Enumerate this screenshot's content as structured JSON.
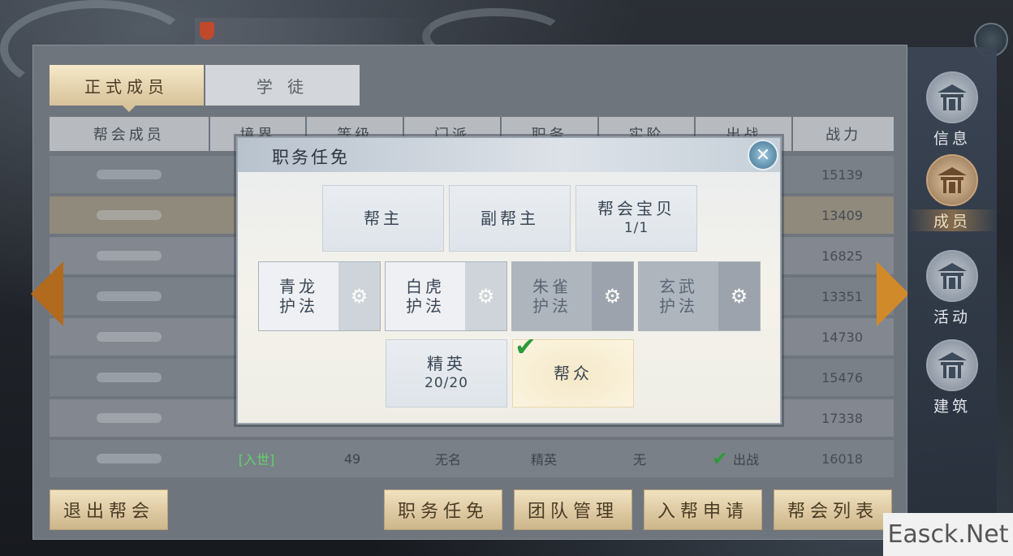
{
  "tabs": [
    {
      "label": "正式成员",
      "active": true
    },
    {
      "label": "学 徒",
      "active": false
    }
  ],
  "table": {
    "headers": [
      "帮会成员",
      "境界",
      "等级",
      "门派",
      "职务",
      "实阶",
      "出战",
      "战力"
    ],
    "powers": [
      "15139",
      "13409",
      "16825",
      "13351",
      "14730",
      "15476",
      "17338",
      "16018"
    ],
    "last_row": {
      "realm": "[入世]",
      "level": "49",
      "school": "无名",
      "position": "精英",
      "rank": "无",
      "battle": "出战",
      "power": "16018"
    }
  },
  "bottom_buttons": {
    "quit": "退出帮会",
    "appoint": "职务任免",
    "team": "团队管理",
    "apply": "入帮申请",
    "list": "帮会列表"
  },
  "sidebar": [
    {
      "label": "信息",
      "icon": "pavilion-icon",
      "active": false
    },
    {
      "label": "成员",
      "icon": "pavilion-icon",
      "active": true
    },
    {
      "label": "活动",
      "icon": "pavilion-icon",
      "active": false
    },
    {
      "label": "建筑",
      "icon": "pavilion-icon",
      "active": false
    }
  ],
  "modal": {
    "title": "职务任免",
    "roles_row1": [
      {
        "label": "帮主",
        "count": ""
      },
      {
        "label": "副帮主",
        "count": ""
      },
      {
        "label": "帮会宝贝",
        "count": "1/1"
      }
    ],
    "roles_row2": [
      {
        "label": "青龙护法",
        "line1": "青龙",
        "line2": "护法",
        "dim": false
      },
      {
        "label": "白虎护法",
        "line1": "白虎",
        "line2": "护法",
        "dim": false
      },
      {
        "label": "朱雀护法",
        "line1": "朱雀",
        "line2": "护法",
        "dim": true
      },
      {
        "label": "玄武护法",
        "line1": "玄武",
        "line2": "护法",
        "dim": true
      }
    ],
    "roles_row3": [
      {
        "label": "精英",
        "count": "20/20",
        "selected": false
      },
      {
        "label": "帮众",
        "count": "",
        "selected": true
      }
    ]
  },
  "watermark": "Easck.Net",
  "colors": {
    "accent_gold": "#d7c29a",
    "check_green": "#2f9a3b",
    "arrow_orange": "#d08a2a"
  }
}
